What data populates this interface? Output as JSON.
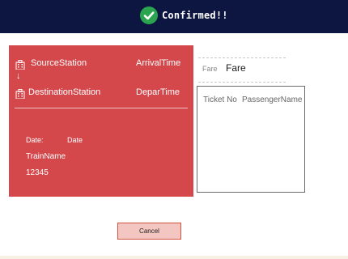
{
  "header": {
    "status_text": "Confirmed!!",
    "status_icon": "check-circle-icon",
    "bar_color": "#0d1640",
    "check_color": "#2aa44f"
  },
  "journey_card": {
    "card_color": "#d4484c",
    "source_station": "SourceStation",
    "arrival_time": "ArrivalTime",
    "direction_arrow": "↓",
    "destination_station": "DestinationStation",
    "departure_time": "DeparTime",
    "date_label": "Date:",
    "date_value": "Date",
    "train_name": "TrainName",
    "train_number": "12345",
    "station_icon": "building-icon"
  },
  "fare": {
    "label": "Fare",
    "value": "Fare"
  },
  "tickets": {
    "columns": [
      "Ticket No",
      "PassengerName"
    ]
  },
  "actions": {
    "cancel_label": "Cancel",
    "cancel_color": "#f4c6c2"
  }
}
